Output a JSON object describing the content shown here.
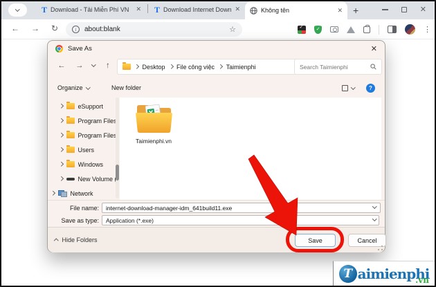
{
  "icons": {
    "back": "←",
    "forward": "→",
    "reload": "↻",
    "up": "↑",
    "star": "☆",
    "overflow": "⋮",
    "close": "✕",
    "plus": "+",
    "info": "i",
    "help": "?",
    "shield_check": "✓",
    "refresh": "↻"
  },
  "browser": {
    "tabs": [
      {
        "label": "Download - Tải Miễn Phí VN"
      },
      {
        "label": "Download Internet Download"
      },
      {
        "label": "Không tên"
      }
    ],
    "address": {
      "url": "about:blank"
    },
    "extensions": [
      "idm-integration",
      "shield",
      "screenshot-camera",
      "mountain",
      "extensions-puzzle"
    ]
  },
  "dialog": {
    "title": "Save As",
    "breadcrumb": {
      "items": [
        "Desktop",
        "File công việc",
        "Taimienphi"
      ]
    },
    "search": {
      "placeholder": "Search Taimienphi"
    },
    "commands": {
      "organize": "Organize",
      "new_folder": "New folder"
    },
    "tree": {
      "items": [
        {
          "label": "eSupport",
          "type": "folder"
        },
        {
          "label": "Program Files",
          "type": "folder"
        },
        {
          "label": "Program Files",
          "type": "folder"
        },
        {
          "label": "Users",
          "type": "folder"
        },
        {
          "label": "Windows",
          "type": "folder"
        },
        {
          "label": "New Volume (",
          "type": "drive"
        },
        {
          "label": "Network",
          "type": "network"
        }
      ]
    },
    "files": [
      {
        "name": "Taimienphi.vn",
        "type": "folder"
      }
    ],
    "file_name": {
      "label": "File name:",
      "value": "internet-download-manager-idm_641build11.exe"
    },
    "save_as_type": {
      "label": "Save as type:",
      "value": "Application (*.exe)"
    },
    "footer": {
      "hide_folders": "Hide Folders",
      "save": "Save",
      "cancel": "Cancel"
    }
  },
  "watermark": {
    "brand_t": "T",
    "brand_rest": "aimienphi",
    "tld": ".vn"
  },
  "colors": {
    "annotation_red": "#ec1309",
    "accent_blue": "#1a73e8",
    "logo_blue": "#1d74b5",
    "logo_green": "#2fae3c"
  }
}
